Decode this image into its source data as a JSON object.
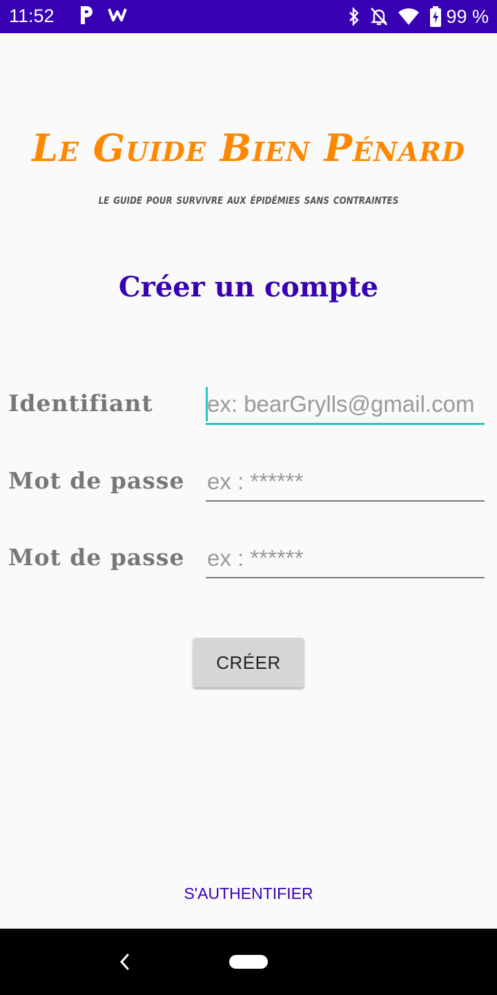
{
  "status_bar": {
    "time": "11:52",
    "battery_percent": "99 %",
    "icons": [
      "p-app-icon",
      "w-app-icon",
      "bluetooth-icon",
      "bell-off-icon",
      "wifi-icon",
      "battery-icon"
    ]
  },
  "app": {
    "title": "Le Guide Bien Pénard",
    "subtitle": "le guide pour survivre aux épidémies sans contraintes"
  },
  "form": {
    "heading": "Créer un compte",
    "fields": [
      {
        "label": "Identifiant",
        "placeholder": "ex: bearGrylls@gmail.com",
        "value": "",
        "focused": true
      },
      {
        "label": "Mot de passe",
        "placeholder": "ex : ******",
        "value": "",
        "focused": false
      },
      {
        "label": "Mot de passe",
        "placeholder": "ex : ******",
        "value": "",
        "focused": false
      }
    ],
    "submit_label": "CRÉER",
    "login_link": "S'AUTHENTIFIER"
  },
  "colors": {
    "status_bar": "#3700b3",
    "title": "#ff8800",
    "accent": "#3700b3",
    "focus_line": "#26c6c0",
    "button_bg": "#d6d6d6"
  }
}
